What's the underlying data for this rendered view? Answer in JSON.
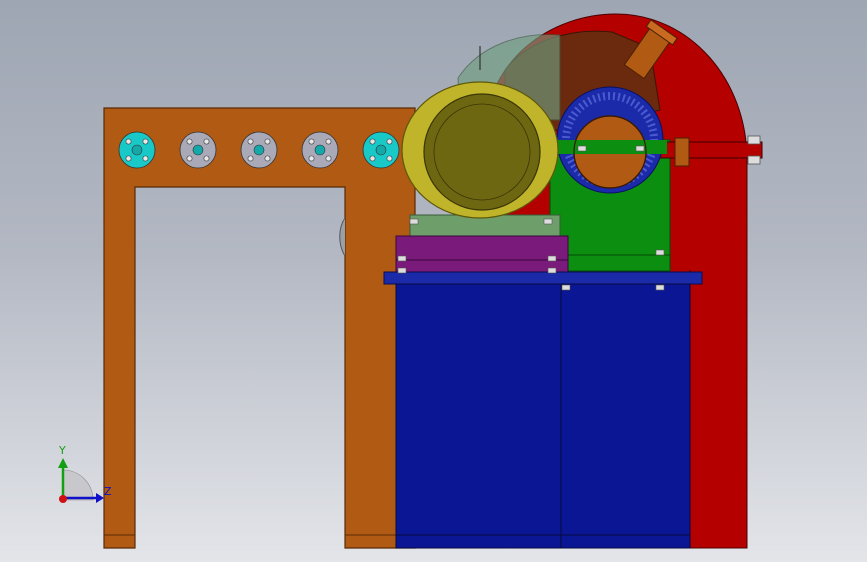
{
  "viewport": {
    "background_top": "#9ea6b3",
    "background_bottom": "#e3e5e9"
  },
  "colors": {
    "frame_brown": "#b05a14",
    "frame_edge": "#5a2a06",
    "hood_red": "#b50000",
    "hood_dark": "#6b2a0e",
    "motor_yellow": "#bfb42a",
    "motor_dark": "#6e6712",
    "gearbox_green": "#0c8f10",
    "plate_purple": "#7a1a7a",
    "base_blue": "#0a1694",
    "flange_blue": "#1a2aa8",
    "flange_cyan": "#18c9c8",
    "flange_gray": "#a9a9b8"
  },
  "flanges": [
    {
      "name": "flange-1",
      "color": "cyan"
    },
    {
      "name": "flange-2",
      "color": "gray"
    },
    {
      "name": "flange-3",
      "color": "gray"
    },
    {
      "name": "flange-4",
      "color": "gray"
    },
    {
      "name": "flange-5",
      "color": "cyan"
    }
  ],
  "triad": {
    "y_label": "Y",
    "z_label": "Z"
  }
}
